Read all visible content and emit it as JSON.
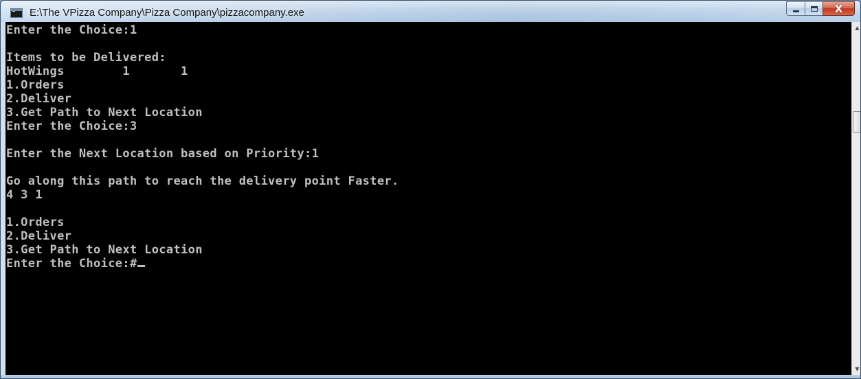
{
  "window": {
    "title": "E:\\The VPizza Company\\Pizza Company\\pizzacompany.exe",
    "icon": "console-app-icon",
    "controls": {
      "minimize_icon": "minimize-icon",
      "maximize_icon": "maximize-icon",
      "close_label": "X"
    }
  },
  "console": {
    "lines": [
      "Enter the Choice:1",
      "",
      "Items to be Delivered:",
      "HotWings        1       1",
      "1.Orders",
      "2.Deliver",
      "3.Get Path to Next Location",
      "Enter the Choice:3",
      "",
      "Enter the Next Location based on Priority:1",
      "",
      "Go along this path to reach the delivery point Faster.",
      "4 3 1",
      "",
      "1.Orders",
      "2.Deliver",
      "3.Get Path to Next Location",
      "Enter the Choice:#"
    ],
    "text_color": "#c0c0c0",
    "background": "#000000"
  },
  "scrollbar": {
    "up_icon": "scroll-up-arrow-icon",
    "down_icon": "scroll-down-arrow-icon"
  }
}
